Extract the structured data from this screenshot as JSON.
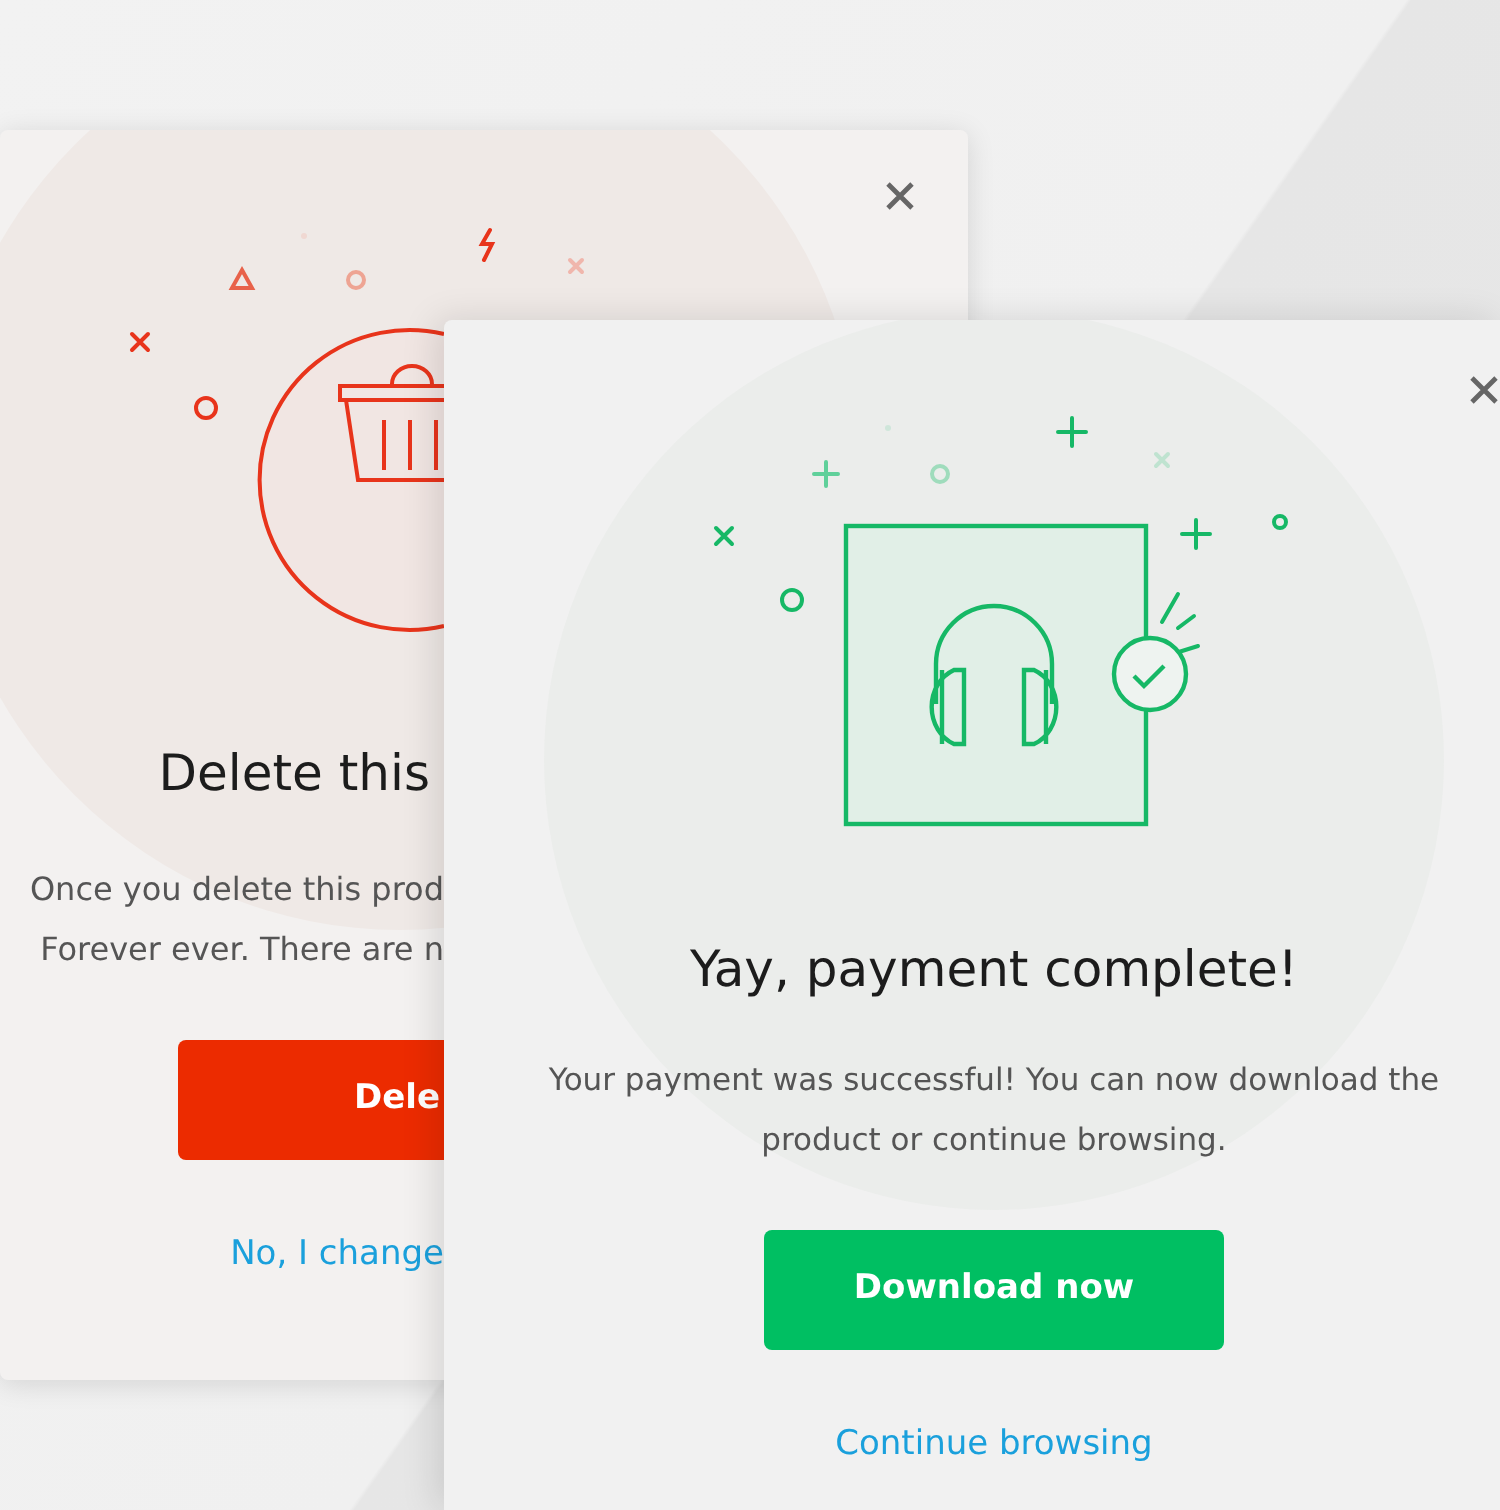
{
  "delete_dialog": {
    "title": "Delete this",
    "message_lines": [
      "Once you delete this prod",
      "Forever ever.  There are n"
    ],
    "confirm_button": "Dele",
    "cancel_link": "No, I change"
  },
  "payment_dialog": {
    "title": "Yay, payment complete!",
    "message": "Your payment was successful! You can now download the product or continue browsing.",
    "primary_button": "Download now",
    "secondary_link": "Continue browsing"
  }
}
